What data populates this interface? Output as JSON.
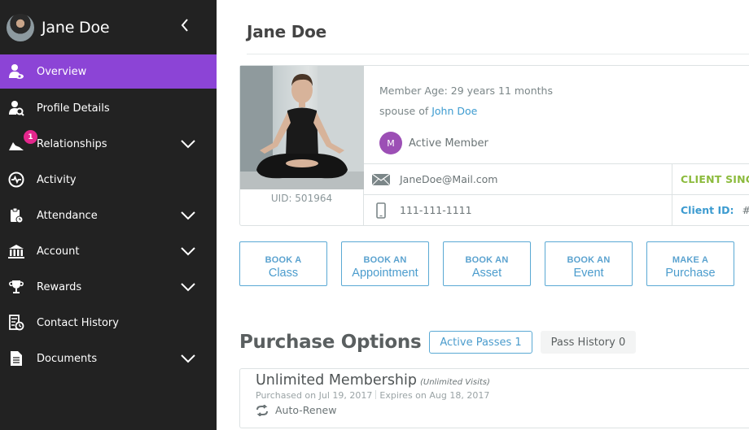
{
  "sidebar": {
    "user_name": "Jane Doe",
    "items": [
      {
        "label": "Overview",
        "icon": "user-eye-icon",
        "active": true,
        "expandable": false
      },
      {
        "label": "Profile Details",
        "icon": "user-search-icon",
        "active": false,
        "expandable": false
      },
      {
        "label": "Relationships",
        "icon": "relationships-icon",
        "active": false,
        "expandable": true,
        "badge": "1"
      },
      {
        "label": "Activity",
        "icon": "activity-icon",
        "active": false,
        "expandable": false
      },
      {
        "label": "Attendance",
        "icon": "clipboard-clock-icon",
        "active": false,
        "expandable": true
      },
      {
        "label": "Account",
        "icon": "bank-icon",
        "active": false,
        "expandable": true
      },
      {
        "label": "Rewards",
        "icon": "trophy-icon",
        "active": false,
        "expandable": true
      },
      {
        "label": "Contact History",
        "icon": "contact-history-icon",
        "active": false,
        "expandable": false
      },
      {
        "label": "Documents",
        "icon": "document-icon",
        "active": false,
        "expandable": true
      }
    ]
  },
  "main": {
    "title": "Jane Doe",
    "profile": {
      "uid": "UID: 501964",
      "member_age": "Member Age: 29 years 11 months",
      "relation_prefix": "spouse of ",
      "relation_name": "John Doe",
      "status_initial": "M",
      "status_label": "Active Member",
      "email": "JaneDoe@Mail.com",
      "phone": "111-111-1111",
      "client_since_label": "CLIENT SINCE:",
      "client_id_label": "Client ID:",
      "client_id_value": "#"
    },
    "actions": [
      {
        "top": "BOOK A",
        "main": "Class"
      },
      {
        "top": "BOOK AN",
        "main": "Appointment"
      },
      {
        "top": "BOOK AN",
        "main": "Asset"
      },
      {
        "top": "BOOK AN",
        "main": "Event"
      },
      {
        "top": "MAKE A",
        "main": "Purchase"
      }
    ],
    "purchase_options": {
      "title": "Purchase Options",
      "tabs": [
        {
          "label": "Active Passes 1",
          "active": true
        },
        {
          "label": "Pass History 0",
          "active": false
        }
      ],
      "pass": {
        "name": "Unlimited Membership",
        "subtitle": "(Unlimited Visits)",
        "purchased": "Purchased on Jul 19, 2017",
        "expires": "Expires on Aug 18, 2017",
        "renew_label": "Auto-Renew"
      }
    }
  },
  "colors": {
    "sidebar_bg": "#222222",
    "active_item": "#8c44d6",
    "badge": "#e4268c",
    "link_blue": "#3c9bd0",
    "client_since_green": "#8cbb3d",
    "status_purple": "#9c4fb5"
  }
}
